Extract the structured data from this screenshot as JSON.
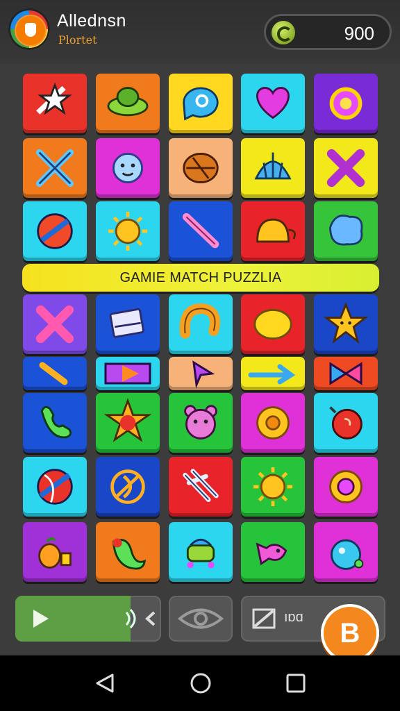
{
  "player": {
    "name": "Allednsn",
    "subtitle": "Plortet"
  },
  "coins": {
    "value": "900"
  },
  "banner": {
    "text": "GAMIE MATCH PUZZLIA"
  },
  "controls": {
    "text_button_label": "ıɒɑ",
    "action_button_label": "B"
  },
  "tiles": [
    {
      "color": "#e8322a",
      "icon": "star-streak-icon"
    },
    {
      "color": "#f07a1c",
      "icon": "green-hat-icon"
    },
    {
      "color": "#ffd81f",
      "icon": "chat-bubble-icon"
    },
    {
      "color": "#2cd6ee",
      "icon": "heart-gem-icon"
    },
    {
      "color": "#7a2bd8",
      "icon": "purple-orb-icon"
    },
    {
      "color": "#f07a1c",
      "icon": "crossed-swords-icon"
    },
    {
      "color": "#e030d8",
      "icon": "cloud-face-icon"
    },
    {
      "color": "#f7b27a",
      "icon": "walnut-icon"
    },
    {
      "color": "#f3e81a",
      "icon": "blue-shell-icon"
    },
    {
      "color": "#f3e81a",
      "icon": "purple-cross-icon"
    },
    {
      "color": "#2cd6ee",
      "icon": "striped-ball-icon"
    },
    {
      "color": "#2cd6ee",
      "icon": "sun-icon"
    },
    {
      "color": "#1a52d8",
      "icon": "pink-wand-icon"
    },
    {
      "color": "#e8232a",
      "icon": "golden-teapot-icon"
    },
    {
      "color": "#36c43a",
      "icon": "puzzle-blob-icon"
    },
    {
      "color": "#7f4ae8",
      "icon": "pink-cross-icon"
    },
    {
      "color": "#1a52d8",
      "icon": "book-stack-icon"
    },
    {
      "color": "#2cd6ee",
      "icon": "croissant-icon"
    },
    {
      "color": "#e8232a",
      "icon": "lemon-icon"
    },
    {
      "color": "#1a46c8",
      "icon": "smiling-star-icon"
    },
    {
      "color": "#1a52d8",
      "icon": "baton-icon"
    },
    {
      "color": "#2cd6ee",
      "icon": "play-arrow-icon"
    },
    {
      "color": "#f7b27a",
      "icon": "cursor-arrow-icon"
    },
    {
      "color": "#f3e81a",
      "icon": "right-arrow-icon"
    },
    {
      "color": "#ef4a22",
      "icon": "bowtie-icon"
    },
    {
      "color": "#1a52d8",
      "icon": "phone-icon"
    },
    {
      "color": "#26c43a",
      "icon": "red-star-icon"
    },
    {
      "color": "#26c43a",
      "icon": "bear-face-icon"
    },
    {
      "color": "#e030d8",
      "icon": "sunflower-icon"
    },
    {
      "color": "#2cd6ee",
      "icon": "red-bomb-icon"
    },
    {
      "color": "#2cd6ee",
      "icon": "beach-ball-icon"
    },
    {
      "color": "#1a46c8",
      "icon": "rune-icon"
    },
    {
      "color": "#e8232a",
      "icon": "lightning-claw-icon"
    },
    {
      "color": "#26c43a",
      "icon": "sun-icon"
    },
    {
      "color": "#e030d8",
      "icon": "pink-sun-icon"
    },
    {
      "color": "#a030d8",
      "icon": "fruit-basket-icon"
    },
    {
      "color": "#f07a1c",
      "icon": "pea-pod-icon"
    },
    {
      "color": "#2cd6ee",
      "icon": "robot-icon"
    },
    {
      "color": "#26c43a",
      "icon": "pink-fish-icon"
    },
    {
      "color": "#e030d8",
      "icon": "blue-potion-icon"
    }
  ]
}
